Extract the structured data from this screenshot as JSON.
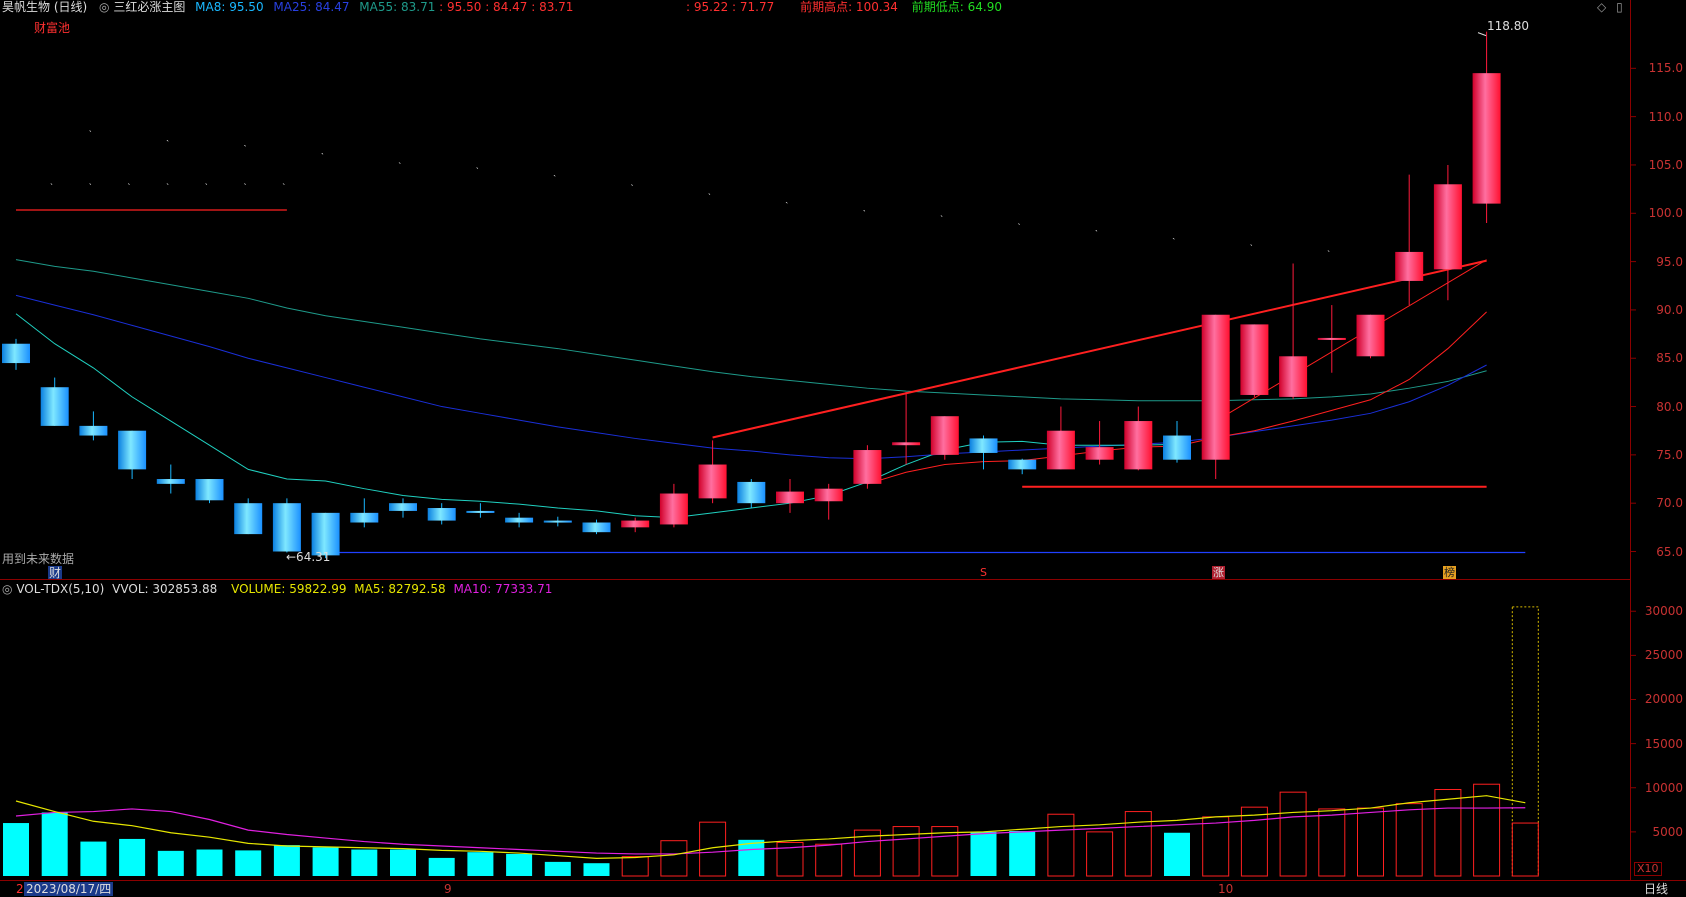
{
  "header": {
    "stock_title": "昊帆生物 (日线)",
    "indicator_name": "三红必涨主图",
    "ma8": "MA8: 95.50",
    "ma25": "MA25: 84.47",
    "ma55": "MA55: 83.71",
    "ma_values": ": 95.50 : 84.47 : 83.71",
    "extra_values": ": 95.22 : 71.77",
    "prev_high": "前期高点: 100.34",
    "prev_low": "前期低点: 64.90",
    "caifuchi": "财富池",
    "future_data": "用到未来数据",
    "cai_marker": "财"
  },
  "volume_header": {
    "name": "VOL-TDX(5,10)",
    "vvol": "VVOL: 302853.88",
    "volume": "VOLUME: 59822.99",
    "ma5": "MA5: 82792.58",
    "ma10": "MA10: 77333.71"
  },
  "annotations": {
    "high_label": "118.80",
    "low_label": "←64.31",
    "marker_s": "S",
    "marker_zhang": "涨",
    "marker_bang": "榜"
  },
  "bottom": {
    "date": "2023/08/17/四",
    "month_9": "9",
    "month_10": "10",
    "period": "日线",
    "x10": "X10",
    "left_digit": "2"
  },
  "colors": {
    "up": "#ff1a3c",
    "down": "#1ab8ff",
    "ma8": "#ff2020",
    "ma25": "#1a2fd8",
    "ma55": "#1e9a8a",
    "vol_ma5": "#e6e600",
    "vol_ma10": "#e020e0",
    "vol_down": "#00ffff"
  },
  "chart_data": {
    "type": "candlestick",
    "price_ylim": [
      63.5,
      120
    ],
    "price_ticks": [
      65,
      70,
      75,
      80,
      85,
      90,
      95,
      100,
      105,
      110,
      115
    ],
    "volume_ylim": [
      0,
      31500
    ],
    "volume_ticks": [
      5000,
      10000,
      15000,
      20000,
      25000,
      30000
    ],
    "candles": [
      {
        "o": 86.5,
        "h": 87,
        "l": 83.8,
        "c": 84.5
      },
      {
        "o": 82,
        "h": 83,
        "l": 78,
        "c": 78
      },
      {
        "o": 78,
        "h": 79.5,
        "l": 76.5,
        "c": 77
      },
      {
        "o": 77.5,
        "h": 77.5,
        "l": 72.5,
        "c": 73.5
      },
      {
        "o": 72.5,
        "h": 74,
        "l": 71,
        "c": 72
      },
      {
        "o": 72.5,
        "h": 72.5,
        "l": 70,
        "c": 70.3
      },
      {
        "o": 70,
        "h": 70.5,
        "l": 66.8,
        "c": 66.8
      },
      {
        "o": 70,
        "h": 70.5,
        "l": 64.9,
        "c": 65
      },
      {
        "o": 69,
        "h": 69,
        "l": 64.31,
        "c": 64.6
      },
      {
        "o": 69,
        "h": 70.5,
        "l": 67.5,
        "c": 68
      },
      {
        "o": 70,
        "h": 70.5,
        "l": 68.5,
        "c": 69.2
      },
      {
        "o": 69.5,
        "h": 70,
        "l": 67.8,
        "c": 68.2
      },
      {
        "o": 69.2,
        "h": 70,
        "l": 68.5,
        "c": 69
      },
      {
        "o": 68.5,
        "h": 69,
        "l": 67.5,
        "c": 68
      },
      {
        "o": 68.2,
        "h": 68.6,
        "l": 67.6,
        "c": 68
      },
      {
        "o": 68,
        "h": 68.3,
        "l": 66.8,
        "c": 67
      },
      {
        "o": 67.5,
        "h": 68.5,
        "l": 67,
        "c": 68.2
      },
      {
        "o": 67.8,
        "h": 72,
        "l": 67.5,
        "c": 71
      },
      {
        "o": 70.5,
        "h": 76.5,
        "l": 70,
        "c": 74
      },
      {
        "o": 72.2,
        "h": 72.5,
        "l": 69.5,
        "c": 70
      },
      {
        "o": 70,
        "h": 72.5,
        "l": 69,
        "c": 71.2
      },
      {
        "o": 70.2,
        "h": 72,
        "l": 68.3,
        "c": 71.5
      },
      {
        "o": 72,
        "h": 76,
        "l": 71.5,
        "c": 75.5
      },
      {
        "o": 76,
        "h": 81.5,
        "l": 74,
        "c": 76.3
      },
      {
        "o": 75,
        "h": 79,
        "l": 74.5,
        "c": 79
      },
      {
        "o": 76.7,
        "h": 77,
        "l": 73.5,
        "c": 75.2
      },
      {
        "o": 74.5,
        "h": 74.6,
        "l": 73,
        "c": 73.5
      },
      {
        "o": 73.5,
        "h": 80,
        "l": 73.5,
        "c": 77.5
      },
      {
        "o": 74.5,
        "h": 78.5,
        "l": 74,
        "c": 75.8
      },
      {
        "o": 73.5,
        "h": 80,
        "l": 73.4,
        "c": 78.5
      },
      {
        "o": 77,
        "h": 78.5,
        "l": 74.2,
        "c": 74.5
      },
      {
        "o": 74.5,
        "h": 89.5,
        "l": 72.5,
        "c": 89.5
      },
      {
        "o": 81.2,
        "h": 88.5,
        "l": 81,
        "c": 88.5
      },
      {
        "o": 81,
        "h": 94.8,
        "l": 80.8,
        "c": 85.2
      },
      {
        "o": 87,
        "h": 90.5,
        "l": 83.5,
        "c": 87.1
      },
      {
        "o": 85.2,
        "h": 89.5,
        "l": 85,
        "c": 89.5
      },
      {
        "o": 93,
        "h": 104,
        "l": 90.5,
        "c": 96
      },
      {
        "o": 94.2,
        "h": 105,
        "l": 91,
        "c": 103
      },
      {
        "o": 101,
        "h": 118.8,
        "l": 99,
        "c": 114.5
      }
    ],
    "ma8": [
      null,
      null,
      null,
      null,
      null,
      null,
      null,
      null,
      null,
      null,
      null,
      null,
      null,
      null,
      null,
      null,
      null,
      null,
      null,
      null,
      null,
      null,
      72.0,
      73.2,
      74.0,
      74.3,
      74.4,
      74.9,
      75.4,
      75.8,
      75.9,
      76.8,
      77.5,
      78.5,
      79.6,
      80.7,
      82.8,
      86.0,
      89.8
    ],
    "ma25": [
      91.5,
      90.5,
      89.5,
      88.4,
      87.3,
      86.2,
      85.0,
      84.0,
      83.0,
      82.0,
      81.0,
      80.0,
      79.3,
      78.6,
      77.9,
      77.3,
      76.7,
      76.2,
      75.7,
      75.4,
      75.0,
      74.7,
      74.6,
      74.8,
      75.1,
      75.3,
      75.5,
      75.7,
      75.9,
      76.1,
      76.3,
      76.8,
      77.4,
      78.0,
      78.6,
      79.3,
      80.5,
      82.2,
      84.3
    ],
    "ma55": [
      95.2,
      94.5,
      94.0,
      93.3,
      92.6,
      91.9,
      91.2,
      90.2,
      89.4,
      88.8,
      88.2,
      87.6,
      87.0,
      86.5,
      86.0,
      85.4,
      84.8,
      84.2,
      83.6,
      83.1,
      82.7,
      82.3,
      81.9,
      81.6,
      81.4,
      81.2,
      81.0,
      80.8,
      80.7,
      80.6,
      80.6,
      80.6,
      80.7,
      80.8,
      81.0,
      81.3,
      81.9,
      82.6,
      83.7
    ],
    "ma_cyan": [
      89.6,
      86.5,
      84.0,
      81.0,
      78.5,
      76.0,
      73.5,
      72.5,
      72.3,
      71.5,
      70.8,
      70.4,
      70.2,
      69.9,
      69.5,
      69.2,
      68.7,
      68.5,
      69.0,
      69.5,
      70.0,
      70.8,
      72.2,
      74.0,
      75.5,
      76.3,
      76.4,
      76.0,
      76.0,
      76.0,
      76.1,
      null,
      null,
      null,
      null,
      null,
      null,
      null,
      null
    ],
    "trend_line": {
      "from": [
        18,
        76.8
      ],
      "to": [
        38,
        95.1
      ]
    },
    "support_line": {
      "from": [
        26,
        71.7
      ],
      "to": [
        38,
        71.7
      ]
    },
    "prev_high_line": {
      "from": [
        0,
        100.34
      ],
      "to": [
        7,
        100.34
      ]
    },
    "prev_low_line": {
      "from": [
        8,
        64.9
      ],
      "to": [
        39,
        64.9
      ]
    },
    "up_signal_line": {
      "from": [
        31,
        78.5
      ],
      "to": [
        38,
        95.2
      ]
    },
    "signal_points": [
      {
        "i": 0,
        "v": 102.8
      },
      {
        "i": 1,
        "v": 102.8
      },
      {
        "i": 2,
        "v": 102.8
      },
      {
        "i": 3,
        "v": 102.8
      },
      {
        "i": 4,
        "v": 102.8
      },
      {
        "i": 5,
        "v": 102.8
      },
      {
        "i": 6,
        "v": 102.8
      },
      {
        "i": 1,
        "v": 108.3
      },
      {
        "i": 3,
        "v": 107.3
      },
      {
        "i": 5,
        "v": 106.8
      },
      {
        "i": 7,
        "v": 106
      },
      {
        "i": 9,
        "v": 105
      },
      {
        "i": 11,
        "v": 104.5
      },
      {
        "i": 13,
        "v": 103.7
      },
      {
        "i": 15,
        "v": 102.7
      },
      {
        "i": 17,
        "v": 101.8
      },
      {
        "i": 19,
        "v": 100.9
      },
      {
        "i": 21,
        "v": 100.1
      },
      {
        "i": 23,
        "v": 99.5
      },
      {
        "i": 25,
        "v": 98.7
      },
      {
        "i": 27,
        "v": 98
      },
      {
        "i": 29,
        "v": 97.2
      },
      {
        "i": 31,
        "v": 96.5
      },
      {
        "i": 33,
        "v": 95.9
      },
      {
        "i": 35,
        "v": 95.3
      }
    ],
    "volumes": [
      6000,
      7200,
      3900,
      4200,
      2850,
      3000,
      2900,
      3500,
      3250,
      3000,
      3000,
      2050,
      2700,
      2500,
      1600,
      1450,
      2200,
      4000,
      6100,
      4100,
      3800,
      3600,
      5200,
      5600,
      5600,
      5000,
      5100,
      7000,
      5000,
      7300,
      4900,
      6700,
      7800,
      9500,
      7600,
      7700,
      8200,
      9800,
      10400,
      30500
    ],
    "vol_last_outline": 30500,
    "vol_last_fill": 6000,
    "vol_ma5": [
      8500,
      7300,
      6200,
      5700,
      4900,
      4400,
      3700,
      3400,
      3300,
      3200,
      3100,
      2900,
      2800,
      2600,
      2300,
      2000,
      2100,
      2400,
      3200,
      3700,
      4000,
      4200,
      4500,
      4700,
      4900,
      5000,
      5300,
      5600,
      5800,
      6100,
      6300,
      6700,
      6900,
      7200,
      7400,
      7700,
      8300,
      8700,
      9100,
      8300
    ],
    "vol_ma10": [
      6800,
      7200,
      7300,
      7600,
      7300,
      6400,
      5200,
      4700,
      4300,
      3900,
      3600,
      3400,
      3200,
      3000,
      2800,
      2600,
      2500,
      2500,
      2700,
      3000,
      3200,
      3500,
      3900,
      4200,
      4500,
      4800,
      5000,
      5200,
      5400,
      5600,
      5800,
      6000,
      6300,
      6700,
      6900,
      7200,
      7500,
      7700,
      7700,
      7733
    ]
  }
}
